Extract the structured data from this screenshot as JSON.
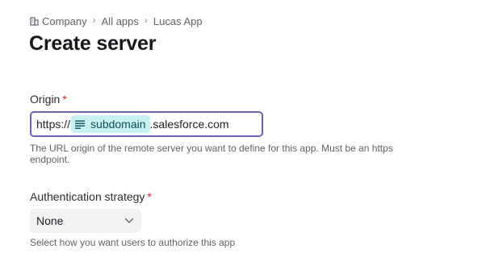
{
  "breadcrumb": {
    "items": [
      {
        "label": "Company",
        "icon": "building-icon"
      },
      {
        "label": "All apps"
      },
      {
        "label": "Lucas App"
      }
    ],
    "separator": "›"
  },
  "page": {
    "title": "Create server"
  },
  "origin": {
    "label": "Origin",
    "required_mark": "*",
    "prefix": "https://",
    "variable": "subdomain",
    "variable_icon": "text-lines-icon",
    "suffix": ".salesforce.com",
    "help": "The URL origin of the remote server you want to define for this app. Must be an https endpoint."
  },
  "auth": {
    "label": "Authentication strategy",
    "required_mark": "*",
    "selected": "None",
    "help": "Select how you want users to authorize this app"
  },
  "colors": {
    "focus_border": "#6b63b5",
    "pill_bg": "#c9f1f1",
    "required": "#c62828"
  }
}
